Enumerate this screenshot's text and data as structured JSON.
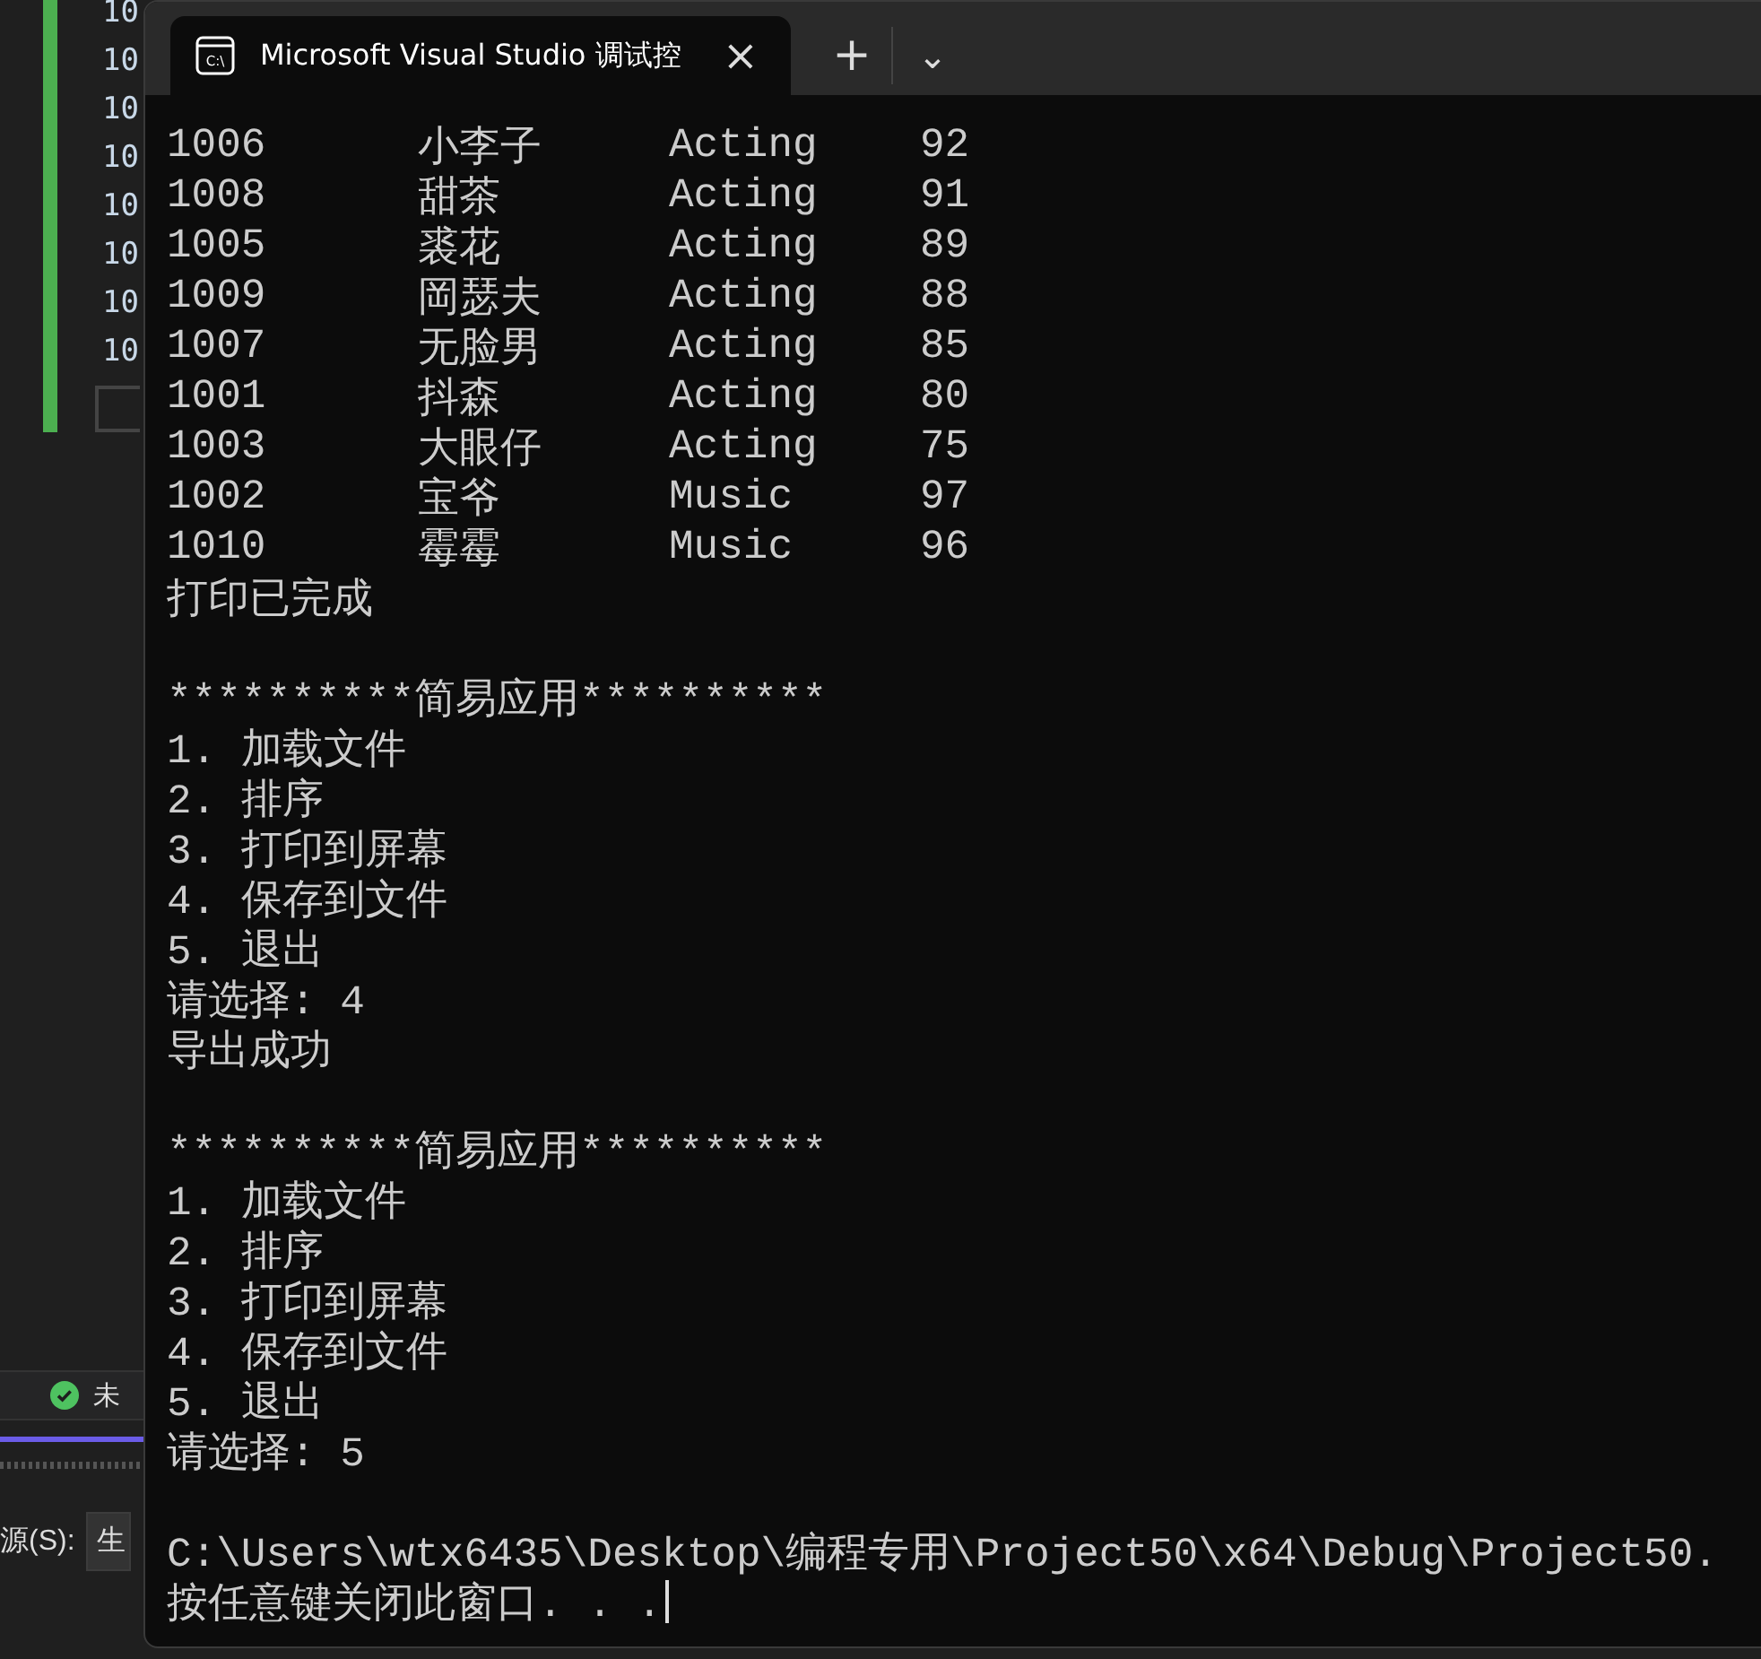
{
  "editor": {
    "line_numbers": [
      "10",
      "10",
      "10",
      "10",
      "10",
      "10",
      "10",
      "10"
    ],
    "status": {
      "text": "未"
    },
    "output_pane": {
      "label": "源(S):",
      "value": "生"
    }
  },
  "terminal": {
    "tab": {
      "icon_text": "C:\\",
      "title": "Microsoft Visual Studio 调试控",
      "close": "×",
      "new_tab": "+",
      "dropdown": "⌄"
    },
    "lines": [
      {
        "kind": "record",
        "cells": [
          "1006",
          "小李子",
          "Acting",
          "92"
        ]
      },
      {
        "kind": "record",
        "cells": [
          "1008",
          "甜茶",
          "Acting",
          "91"
        ]
      },
      {
        "kind": "record",
        "cells": [
          "1005",
          "裘花",
          "Acting",
          "89"
        ]
      },
      {
        "kind": "record",
        "cells": [
          "1009",
          "岡瑟夫",
          "Acting",
          "88"
        ]
      },
      {
        "kind": "record",
        "cells": [
          "1007",
          "无脸男",
          "Acting",
          "85"
        ]
      },
      {
        "kind": "record",
        "cells": [
          "1001",
          "抖森",
          "Acting",
          "80"
        ]
      },
      {
        "kind": "record",
        "cells": [
          "1003",
          "大眼仔",
          "Acting",
          "75"
        ]
      },
      {
        "kind": "record",
        "cells": [
          "1002",
          "宝爷",
          "Music",
          "97"
        ]
      },
      {
        "kind": "record",
        "cells": [
          "1010",
          "霉霉",
          "Music",
          "96"
        ]
      },
      {
        "kind": "text",
        "text": "打印已完成"
      },
      {
        "kind": "blank"
      },
      {
        "kind": "text",
        "text": "**********简易应用**********"
      },
      {
        "kind": "text",
        "text": "1. 加载文件"
      },
      {
        "kind": "text",
        "text": "2. 排序"
      },
      {
        "kind": "text",
        "text": "3. 打印到屏幕"
      },
      {
        "kind": "text",
        "text": "4. 保存到文件"
      },
      {
        "kind": "text",
        "text": "5. 退出"
      },
      {
        "kind": "text",
        "text": "请选择: 4"
      },
      {
        "kind": "text",
        "text": "导出成功"
      },
      {
        "kind": "blank"
      },
      {
        "kind": "text",
        "text": "**********简易应用**********"
      },
      {
        "kind": "text",
        "text": "1. 加载文件"
      },
      {
        "kind": "text",
        "text": "2. 排序"
      },
      {
        "kind": "text",
        "text": "3. 打印到屏幕"
      },
      {
        "kind": "text",
        "text": "4. 保存到文件"
      },
      {
        "kind": "text",
        "text": "5. 退出"
      },
      {
        "kind": "text",
        "text": "请选择: 5"
      },
      {
        "kind": "blank"
      },
      {
        "kind": "text",
        "text": "C:\\Users\\wtx6435\\Desktop\\编程专用\\Project50\\x64\\Debug\\Project50."
      },
      {
        "kind": "prompt",
        "text": "按任意键关闭此窗口. . ."
      }
    ]
  }
}
